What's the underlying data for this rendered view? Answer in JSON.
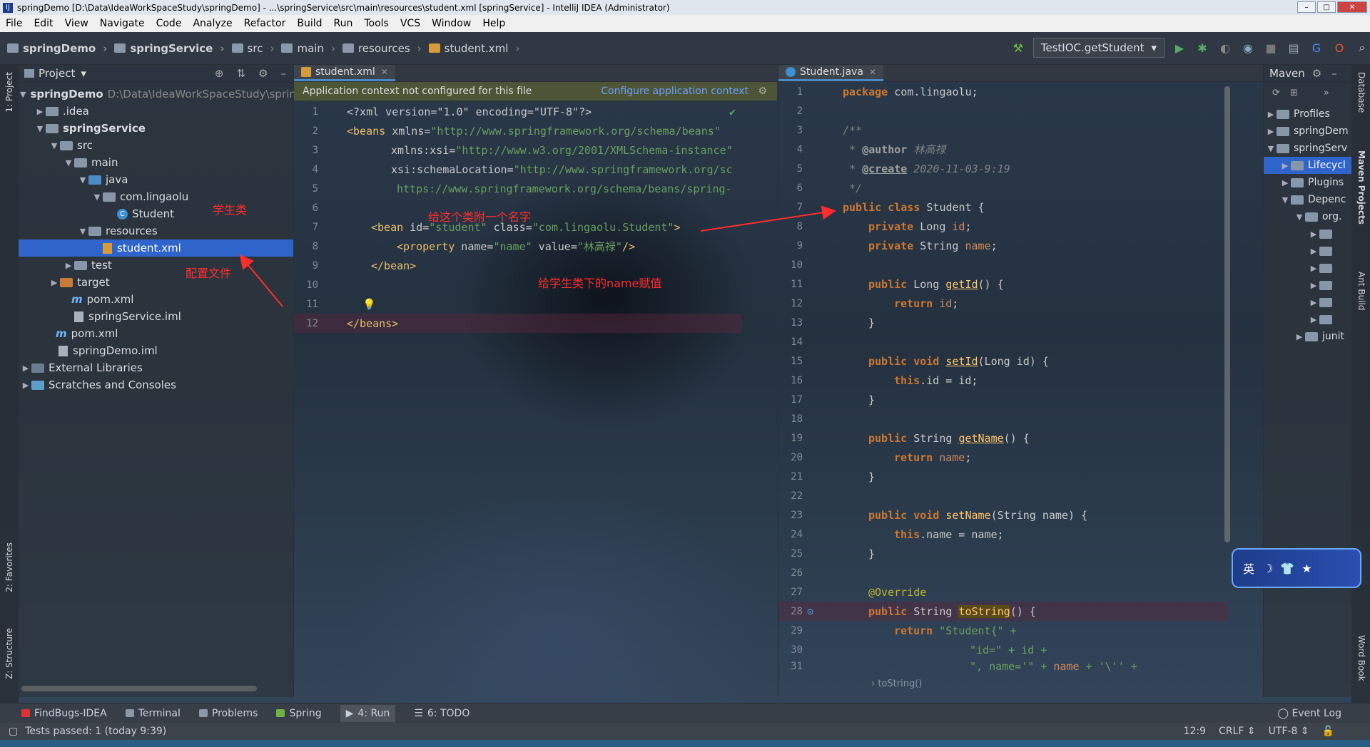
{
  "window": {
    "title": "springDemo [D:\\Data\\IdeaWorkSpaceStudy\\springDemo] - ...\\springService\\src\\main\\resources\\student.xml [springService] - IntelliJ IDEA (Administrator)"
  },
  "menu": [
    "File",
    "Edit",
    "View",
    "Navigate",
    "Code",
    "Analyze",
    "Refactor",
    "Build",
    "Run",
    "Tools",
    "VCS",
    "Window",
    "Help"
  ],
  "breadcrumbs": [
    "springDemo",
    "springService",
    "src",
    "main",
    "resources",
    "student.xml"
  ],
  "toolbar": {
    "run_config": "TestIOC.getStudent"
  },
  "left_strip": {
    "project": "1: Project",
    "favorites": "2: Favorites",
    "structure": "Z: Structure"
  },
  "right_strip": {
    "database": "Database",
    "maven": "Maven Projects",
    "ant": "Ant Build",
    "wordbook": "Word Book"
  },
  "project_panel": {
    "title": "Project",
    "tree": [
      {
        "label": "springDemo",
        "path": "D:\\Data\\IdeaWorkSpaceStudy\\sprin"
      },
      {
        "label": ".idea"
      },
      {
        "label": "springService"
      },
      {
        "label": "src"
      },
      {
        "label": "main"
      },
      {
        "label": "java"
      },
      {
        "label": "com.lingaolu"
      },
      {
        "label": "Student"
      },
      {
        "label": "resources"
      },
      {
        "label": "student.xml"
      },
      {
        "label": "test"
      },
      {
        "label": "target"
      },
      {
        "label": "pom.xml"
      },
      {
        "label": "springService.iml"
      },
      {
        "label": "pom.xml"
      },
      {
        "label": "springDemo.iml"
      },
      {
        "label": "External Libraries"
      },
      {
        "label": "Scratches and Consoles"
      }
    ]
  },
  "annotations": {
    "student_class": "学生类",
    "config_file": "配置文件",
    "name_class": "给这个类附一个名字",
    "assign_name": "给学生类下的name赋值"
  },
  "editor_left": {
    "tab": "student.xml",
    "banner": "Application context not configured for this file",
    "banner_link": "Configure application context",
    "lines": [
      "1",
      "2",
      "3",
      "4",
      "5",
      "6",
      "7",
      "8",
      "9",
      "10",
      "11",
      "12"
    ],
    "code": {
      "l1": "<?xml version=\"1.0\" encoding=\"UTF-8\"?>",
      "l2a": "<beans",
      "l2b": " xmlns=",
      "l2c": "\"http://www.springframework.org/schema/beans\"",
      "l3a": "xmlns:xsi=",
      "l3b": "\"http://www.w3.org/2001/XMLSchema-instance\"",
      "l4a": "xsi:schemaLocation=",
      "l4b": "\"http://www.springframework.org/sc",
      "l5": "https://www.springframework.org/schema/beans/spring-",
      "l7a": "<bean",
      "l7b": " id=",
      "l7c": "\"student\"",
      "l7d": " class=",
      "l7e": "\"com.lingaolu.Student\"",
      "l7f": ">",
      "l8a": "<property",
      "l8b": " name=",
      "l8c": "\"name\"",
      "l8d": " value=",
      "l8e": "\"林高禄\"",
      "l8f": "/>",
      "l9": "</bean>",
      "l12": "</beans>"
    }
  },
  "editor_right": {
    "tab": "Student.java",
    "lines": [
      "1",
      "2",
      "3",
      "4",
      "5",
      "6",
      "7",
      "8",
      "9",
      "10",
      "11",
      "12",
      "13",
      "14",
      "15",
      "16",
      "17",
      "18",
      "19",
      "20",
      "21",
      "22",
      "23",
      "24",
      "25",
      "26",
      "27",
      "28",
      "29",
      "30",
      "31"
    ],
    "code": {
      "pkg_kw": "package",
      "pkg": " com.lingaolu;",
      "c3": "/**",
      "c4a": " * ",
      "c4b": "@author",
      "c4c": " 林高禄",
      "c5a": " * ",
      "c5b": "@create",
      "c5c": " 2020-11-03-9:19",
      "c6": " */",
      "cls_kw": "public class",
      "cls": " Student {",
      "f1kw": "private",
      "f1t": " Long ",
      "f1n": "id",
      "f2kw": "private",
      "f2t": " String ",
      "f2n": "name",
      "semi": ";",
      "pub": "public",
      "m1t": " Long ",
      "m1n": "getId",
      "m1p": "() {",
      "ret": "return",
      "r1": " id",
      "close": "}",
      "void": " void ",
      "m2n": "setId",
      "m2p": "(Long id) {",
      "this_kw": "this",
      "m2b": ".id = id;",
      "m3t": " String ",
      "m3n": "getName",
      "m3p": "() {",
      "r3": " name",
      "m4n": "setName",
      "m4p": "(String name) {",
      "m4b": ".name = name;",
      "ovr": "@Override",
      "m5t": " String ",
      "m5n": "toString",
      "m5p": "() {",
      "s29": " \"Student{\" +",
      "s30": "\"id=\" + id +",
      "s31a": "\", name='\" + ",
      "s31b": "name",
      "s31c": " + '\\'' +"
    },
    "breadcrumb": "toString()"
  },
  "maven_panel": {
    "title": "Maven",
    "tree": [
      "Profiles",
      "springDem",
      "springServ",
      "Lifecycl",
      "Plugins",
      "Depenc",
      "org.",
      "junit"
    ]
  },
  "ime": "英",
  "bottom_tabs": [
    "FindBugs-IDEA",
    "Terminal",
    "Problems",
    "Spring",
    "4: Run",
    "6: TODO"
  ],
  "event_log": "Event Log",
  "status": {
    "message": "Tests passed: 1 (today 9:39)",
    "position": "12:9",
    "line_sep": "CRLF",
    "encoding": "UTF-8"
  }
}
